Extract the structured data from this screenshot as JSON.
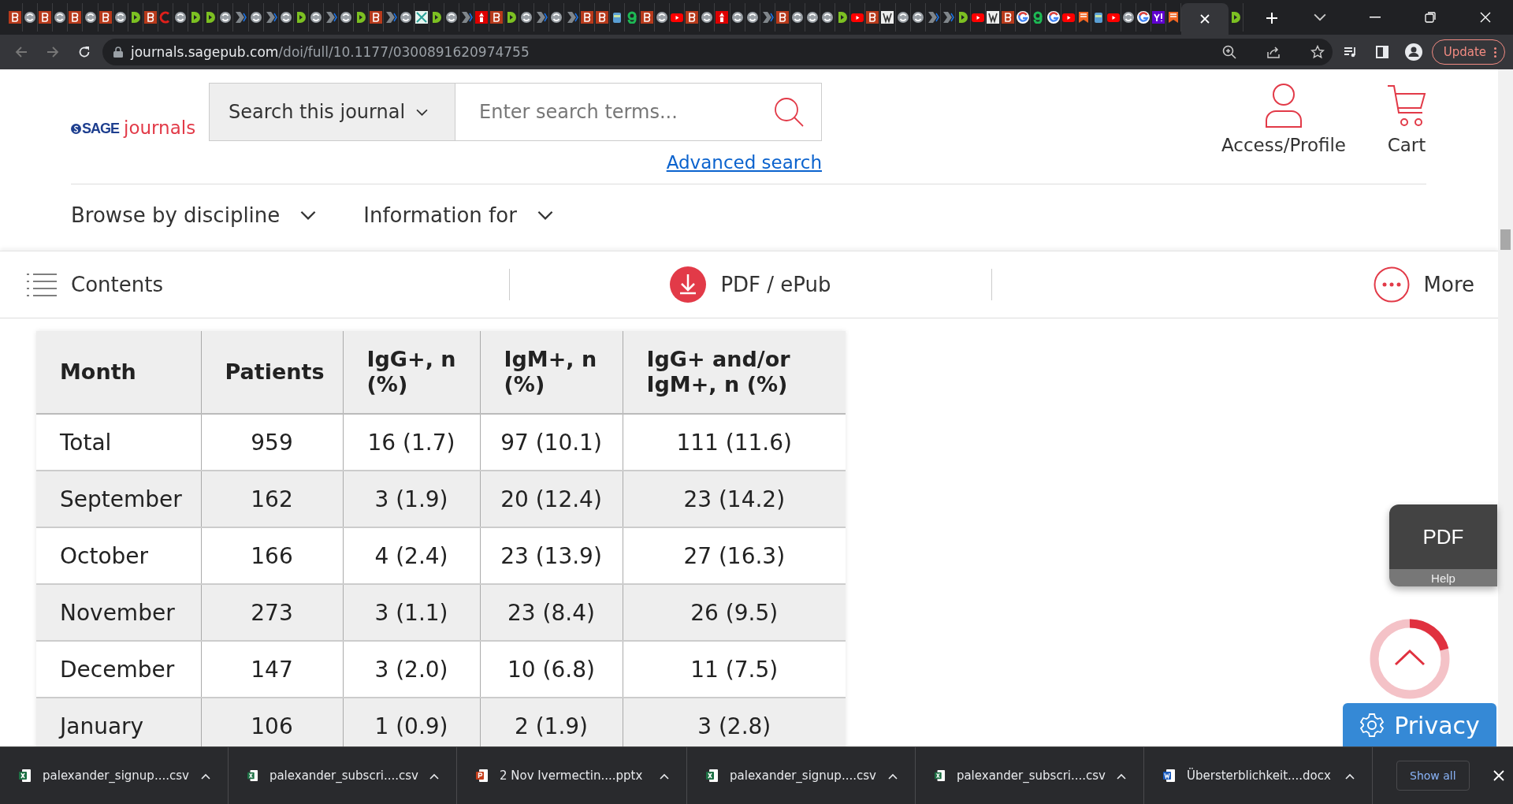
{
  "browser": {
    "tabs": [
      {
        "kind": "b",
        "selected": false
      },
      {
        "kind": "c",
        "selected": false
      },
      {
        "kind": "b",
        "selected": false
      },
      {
        "kind": "c",
        "selected": false
      },
      {
        "kind": "b",
        "selected": false
      },
      {
        "kind": "c",
        "selected": false
      },
      {
        "kind": "b",
        "selected": false
      },
      {
        "kind": "c",
        "selected": false
      },
      {
        "kind": "d",
        "selected": false
      },
      {
        "kind": "b",
        "selected": false
      },
      {
        "kind": "r",
        "selected": false
      },
      {
        "kind": "c",
        "selected": false
      },
      {
        "kind": "d",
        "selected": false
      },
      {
        "kind": "d",
        "selected": false
      },
      {
        "kind": "c",
        "selected": false
      },
      {
        "kind": "a",
        "selected": false
      },
      {
        "kind": "c",
        "selected": false
      },
      {
        "kind": "a",
        "selected": false
      },
      {
        "kind": "c",
        "selected": false
      },
      {
        "kind": "d",
        "selected": false
      },
      {
        "kind": "c",
        "selected": false
      },
      {
        "kind": "a",
        "selected": false
      },
      {
        "kind": "c",
        "selected": false
      },
      {
        "kind": "d",
        "selected": false
      },
      {
        "kind": "b",
        "selected": false
      },
      {
        "kind": "a",
        "selected": false
      },
      {
        "kind": "c",
        "selected": false
      },
      {
        "kind": "x",
        "selected": false
      },
      {
        "kind": "d",
        "selected": false
      },
      {
        "kind": "c",
        "selected": false
      },
      {
        "kind": "a",
        "selected": false
      },
      {
        "kind": "v",
        "selected": false
      },
      {
        "kind": "b",
        "selected": false
      },
      {
        "kind": "d",
        "selected": false
      },
      {
        "kind": "c",
        "selected": false
      },
      {
        "kind": "a",
        "selected": false
      },
      {
        "kind": "c",
        "selected": false
      },
      {
        "kind": "a",
        "selected": false
      },
      {
        "kind": "b",
        "selected": false
      },
      {
        "kind": "b",
        "selected": false
      },
      {
        "kind": "t",
        "selected": false
      },
      {
        "kind": "gg",
        "selected": false
      },
      {
        "kind": "b",
        "selected": false
      },
      {
        "kind": "c",
        "selected": false
      },
      {
        "kind": "y",
        "selected": false
      },
      {
        "kind": "b",
        "selected": false
      },
      {
        "kind": "c",
        "selected": false
      },
      {
        "kind": "v",
        "selected": false
      },
      {
        "kind": "c",
        "selected": false
      },
      {
        "kind": "c",
        "selected": false
      },
      {
        "kind": "a",
        "selected": false
      },
      {
        "kind": "b",
        "selected": false
      },
      {
        "kind": "c",
        "selected": false
      },
      {
        "kind": "c",
        "selected": false
      },
      {
        "kind": "c",
        "selected": false
      },
      {
        "kind": "d",
        "selected": false
      },
      {
        "kind": "y",
        "selected": false
      },
      {
        "kind": "b",
        "selected": false
      },
      {
        "kind": "w",
        "selected": false
      },
      {
        "kind": "c",
        "selected": false
      },
      {
        "kind": "c",
        "selected": false
      },
      {
        "kind": "a",
        "selected": false
      },
      {
        "kind": "a",
        "selected": false
      },
      {
        "kind": "d",
        "selected": false
      },
      {
        "kind": "y",
        "selected": false
      },
      {
        "kind": "w",
        "selected": false
      },
      {
        "kind": "b",
        "selected": false
      },
      {
        "kind": "g",
        "selected": false
      },
      {
        "kind": "gg",
        "selected": false
      },
      {
        "kind": "g",
        "selected": false
      },
      {
        "kind": "y",
        "selected": false
      },
      {
        "kind": "k",
        "selected": false
      },
      {
        "kind": "t",
        "selected": false
      },
      {
        "kind": "y",
        "selected": false
      },
      {
        "kind": "c",
        "selected": false
      },
      {
        "kind": "g",
        "selected": false
      },
      {
        "kind": "yh",
        "selected": false
      },
      {
        "kind": "k",
        "selected": false
      },
      {
        "selected": true
      },
      {
        "kind": "d",
        "selected": false
      }
    ],
    "url_host": "journals.sagepub.com",
    "url_path": "/doi/full/10.1177/0300891620974755",
    "update_button": "Update"
  },
  "header": {
    "logo_brand": "SAGE",
    "logo_word": "journals",
    "search_scope": "Search this journal",
    "search_placeholder": "Enter search terms...",
    "advanced_search": "Advanced search",
    "profile": "Access/Profile",
    "cart": "Cart"
  },
  "nav": [
    "Browse by discipline",
    "Information for"
  ],
  "toolbar": {
    "contents": "Contents",
    "pdf": "PDF / ePub",
    "more": "More"
  },
  "table": {
    "columns": [
      "Month",
      "Patients",
      "IgG+, n (%)",
      "IgM+, n (%)",
      "IgG+ and/or IgM+, n (%)"
    ],
    "rows": [
      [
        "Total",
        "959",
        "16 (1.7)",
        "97 (10.1)",
        "111 (11.6)"
      ],
      [
        "September",
        "162",
        "3 (1.9)",
        "20 (12.4)",
        "23 (14.2)"
      ],
      [
        "October",
        "166",
        "4 (2.4)",
        "23 (13.9)",
        "27 (16.3)"
      ],
      [
        "November",
        "273",
        "3 (1.1)",
        "23 (8.4)",
        "26 (9.5)"
      ],
      [
        "December",
        "147",
        "3 (2.0)",
        "10 (6.8)",
        "11 (7.5)"
      ],
      [
        "January",
        "106",
        "1 (0.9)",
        "2 (1.9)",
        "3 (2.8)"
      ]
    ]
  },
  "pdf_help": {
    "title": "PDF",
    "subtitle": "Help"
  },
  "privacy_button": "Privacy",
  "downloads": [
    {
      "name": "palexander_signup....csv",
      "kind": "xls"
    },
    {
      "name": "palexander_subscri....csv",
      "kind": "xls"
    },
    {
      "name": "2 Nov Ivermectin....pptx",
      "kind": "ppt"
    },
    {
      "name": "palexander_signup....csv",
      "kind": "xls"
    },
    {
      "name": "palexander_subscri....csv",
      "kind": "xls"
    },
    {
      "name": "Übersterblichkeit....docx",
      "kind": "doc"
    }
  ],
  "show_all": "Show all"
}
